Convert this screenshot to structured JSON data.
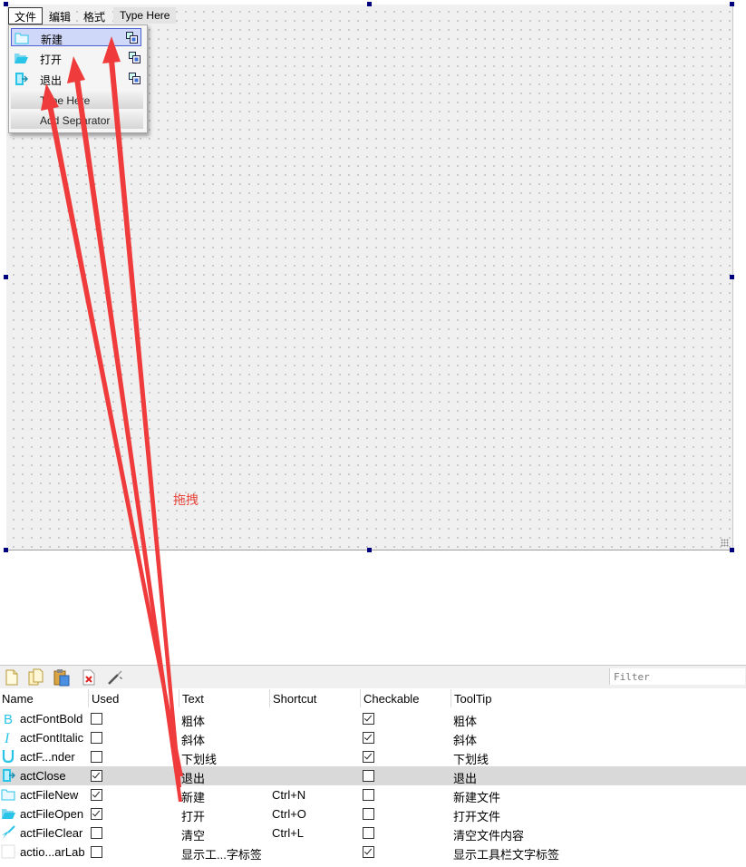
{
  "menubar": {
    "items": [
      {
        "label": "文件"
      },
      {
        "label": "编辑"
      },
      {
        "label": "格式"
      },
      {
        "label": "Type Here"
      }
    ]
  },
  "file_menu": {
    "items": [
      {
        "label": "新建",
        "icon": "folder-outline-icon"
      },
      {
        "label": "打开",
        "icon": "folder-open-icon"
      },
      {
        "label": "退出",
        "icon": "exit-door-icon"
      }
    ],
    "type_here": "Type Here",
    "add_separator": "Add Separator"
  },
  "annotation": {
    "text": "拖拽",
    "color": "#e8453c"
  },
  "action_editor": {
    "filter_placeholder": "Filter",
    "toolbar_icons": [
      "new-action-icon",
      "copy-action-icon",
      "paste-action-icon",
      "delete-action-icon",
      "configure-icon"
    ],
    "columns": [
      "Name",
      "Used",
      "Text",
      "Shortcut",
      "Checkable",
      "ToolTip"
    ],
    "rows": [
      {
        "name": "actFontBold",
        "used": false,
        "text": "粗体",
        "shortcut": "",
        "checkable": true,
        "tooltip": "粗体",
        "icon": "bold-icon"
      },
      {
        "name": "actFontItalic",
        "used": false,
        "text": "斜体",
        "shortcut": "",
        "checkable": true,
        "tooltip": "斜体",
        "icon": "italic-icon"
      },
      {
        "name": "actF...nder",
        "used": false,
        "text": "下划线",
        "shortcut": "",
        "checkable": true,
        "tooltip": "下划线",
        "icon": "underline-icon"
      },
      {
        "name": "actClose",
        "used": true,
        "text": "退出",
        "shortcut": "",
        "checkable": false,
        "tooltip": "退出",
        "icon": "exit-door-icon"
      },
      {
        "name": "actFileNew",
        "used": true,
        "text": "新建",
        "shortcut": "Ctrl+N",
        "checkable": false,
        "tooltip": "新建文件",
        "icon": "folder-outline-icon"
      },
      {
        "name": "actFileOpen",
        "used": true,
        "text": "打开",
        "shortcut": "Ctrl+O",
        "checkable": false,
        "tooltip": "打开文件",
        "icon": "folder-open-icon"
      },
      {
        "name": "actFileClear",
        "used": false,
        "text": "清空",
        "shortcut": "Ctrl+L",
        "checkable": false,
        "tooltip": "清空文件内容",
        "icon": "broom-icon"
      },
      {
        "name": "actio...arLab",
        "used": false,
        "text": "显示工...字标签",
        "shortcut": "",
        "checkable": true,
        "tooltip": "显示工具栏文字标签",
        "icon": "blank-icon"
      }
    ]
  },
  "colors": {
    "accent_cyan": "#29c4e8",
    "arrow_red": "#ef3b3b",
    "selection_blue": "#4a5fcf",
    "highlight_row": "#d9d9d9"
  }
}
